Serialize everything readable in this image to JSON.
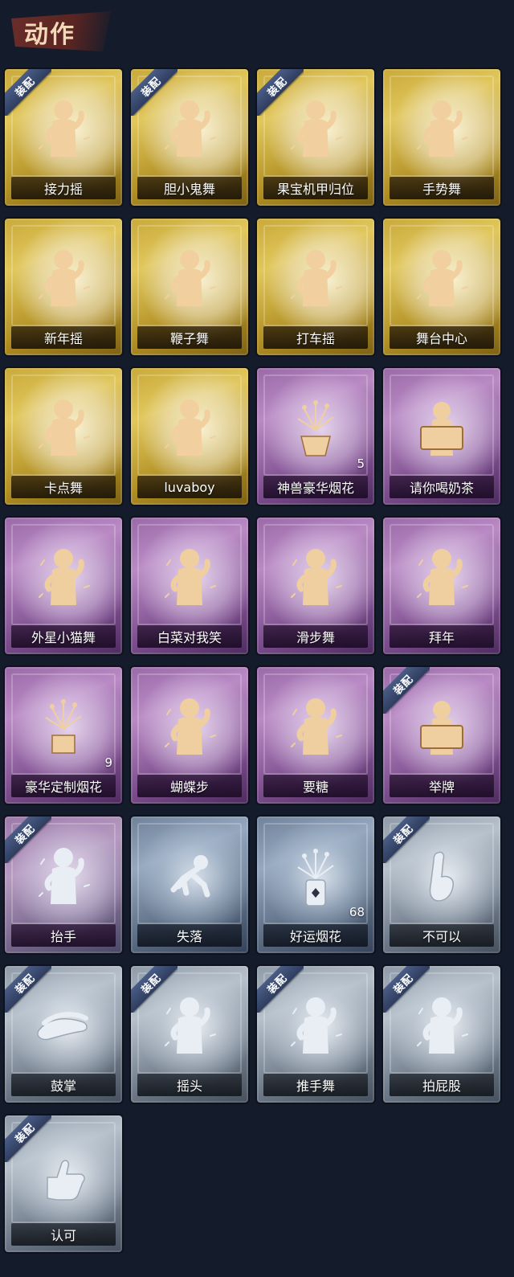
{
  "header": {
    "title": "动作"
  },
  "badge_label": "装配",
  "cards": [
    {
      "label": "接力摇",
      "tier": "gold",
      "equipped": true,
      "count": null,
      "icon": "dance-figure-icon"
    },
    {
      "label": "胆小鬼舞",
      "tier": "gold",
      "equipped": true,
      "count": null,
      "icon": "dance-figure-icon"
    },
    {
      "label": "果宝机甲归位",
      "tier": "gold",
      "equipped": true,
      "count": null,
      "icon": "dance-figure-icon"
    },
    {
      "label": "手势舞",
      "tier": "gold",
      "equipped": false,
      "count": null,
      "icon": "dance-figure-icon"
    },
    {
      "label": "新年摇",
      "tier": "gold",
      "equipped": false,
      "count": null,
      "icon": "dance-figure-icon"
    },
    {
      "label": "鞭子舞",
      "tier": "gold",
      "equipped": false,
      "count": null,
      "icon": "dance-figure-icon"
    },
    {
      "label": "打车摇",
      "tier": "gold",
      "equipped": false,
      "count": null,
      "icon": "dance-figure-icon"
    },
    {
      "label": "舞台中心",
      "tier": "gold",
      "equipped": false,
      "count": null,
      "icon": "dance-figure-icon"
    },
    {
      "label": "卡点舞",
      "tier": "gold",
      "equipped": false,
      "count": null,
      "icon": "dance-figure-icon"
    },
    {
      "label": "luvaboy",
      "tier": "gold",
      "equipped": false,
      "count": null,
      "icon": "dance-figure-icon"
    },
    {
      "label": "神兽豪华烟花",
      "tier": "purple",
      "equipped": false,
      "count": "5",
      "icon": "fireworks-pot-icon"
    },
    {
      "label": "请你喝奶茶",
      "tier": "purple",
      "equipped": false,
      "count": null,
      "icon": "figure-with-sign-icon"
    },
    {
      "label": "外星小猫舞",
      "tier": "purple",
      "equipped": false,
      "count": null,
      "icon": "dance-figure-icon"
    },
    {
      "label": "白菜对我笑",
      "tier": "purple",
      "equipped": false,
      "count": null,
      "icon": "dance-figure-icon"
    },
    {
      "label": "滑步舞",
      "tier": "purple",
      "equipped": false,
      "count": null,
      "icon": "dance-figure-icon"
    },
    {
      "label": "拜年",
      "tier": "purple",
      "equipped": false,
      "count": null,
      "icon": "bowing-figure-icon"
    },
    {
      "label": "豪华定制烟花",
      "tier": "purple",
      "equipped": false,
      "count": "9",
      "icon": "fireworks-box-icon"
    },
    {
      "label": "蝴蝶步",
      "tier": "purple",
      "equipped": false,
      "count": null,
      "icon": "dance-figure-icon"
    },
    {
      "label": "要糖",
      "tier": "purple",
      "equipped": false,
      "count": null,
      "icon": "reaching-figure-icon"
    },
    {
      "label": "举牌",
      "tier": "purple",
      "equipped": true,
      "count": null,
      "icon": "figure-with-sign-icon"
    },
    {
      "label": "抬手",
      "tier": "mixed",
      "equipped": true,
      "count": null,
      "icon": "raising-hand-figure-icon"
    },
    {
      "label": "失落",
      "tier": "steel",
      "equipped": false,
      "count": null,
      "icon": "crawling-figure-icon"
    },
    {
      "label": "好运烟花",
      "tier": "steel",
      "equipped": false,
      "count": "68",
      "icon": "firework-can-icon"
    },
    {
      "label": "不可以",
      "tier": "silver",
      "equipped": true,
      "count": null,
      "icon": "finger-wag-icon"
    },
    {
      "label": "鼓掌",
      "tier": "silver",
      "equipped": true,
      "count": null,
      "icon": "clapping-hands-icon"
    },
    {
      "label": "摇头",
      "tier": "silver",
      "equipped": true,
      "count": null,
      "icon": "shaking-head-figure-icon"
    },
    {
      "label": "推手舞",
      "tier": "silver",
      "equipped": true,
      "count": null,
      "icon": "pushing-figure-icon"
    },
    {
      "label": "拍屁股",
      "tier": "silver",
      "equipped": true,
      "count": null,
      "icon": "walking-figure-icon"
    },
    {
      "label": "认可",
      "tier": "silver",
      "equipped": true,
      "count": null,
      "icon": "thumbs-up-icon"
    }
  ]
}
